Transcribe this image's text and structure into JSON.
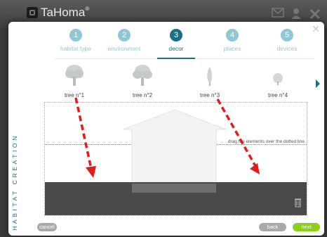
{
  "app": {
    "brand": "TaHoma"
  },
  "steps": [
    {
      "number": "1",
      "label": "habitat type"
    },
    {
      "number": "2",
      "label": "environment"
    },
    {
      "number": "3",
      "label": "decor"
    },
    {
      "number": "4",
      "label": "places"
    },
    {
      "number": "5",
      "label": "devices"
    }
  ],
  "trees": [
    {
      "label": "tree n°1"
    },
    {
      "label": "tree n°2"
    },
    {
      "label": "tree n°3"
    },
    {
      "label": "tree n°4"
    }
  ],
  "sidebar_title": "HABITAT CREATION",
  "canvas": {
    "hint": "drag the elements over the dotted line"
  },
  "buttons": {
    "cancel": "cancel",
    "back": "back",
    "next": "next"
  },
  "colors": {
    "accent": "#1a6f84",
    "step_inactive": "#8ec8d6",
    "next_button": "#8ccf1d",
    "arrow": "#e21b1b",
    "ground": "#4a4a4a"
  }
}
